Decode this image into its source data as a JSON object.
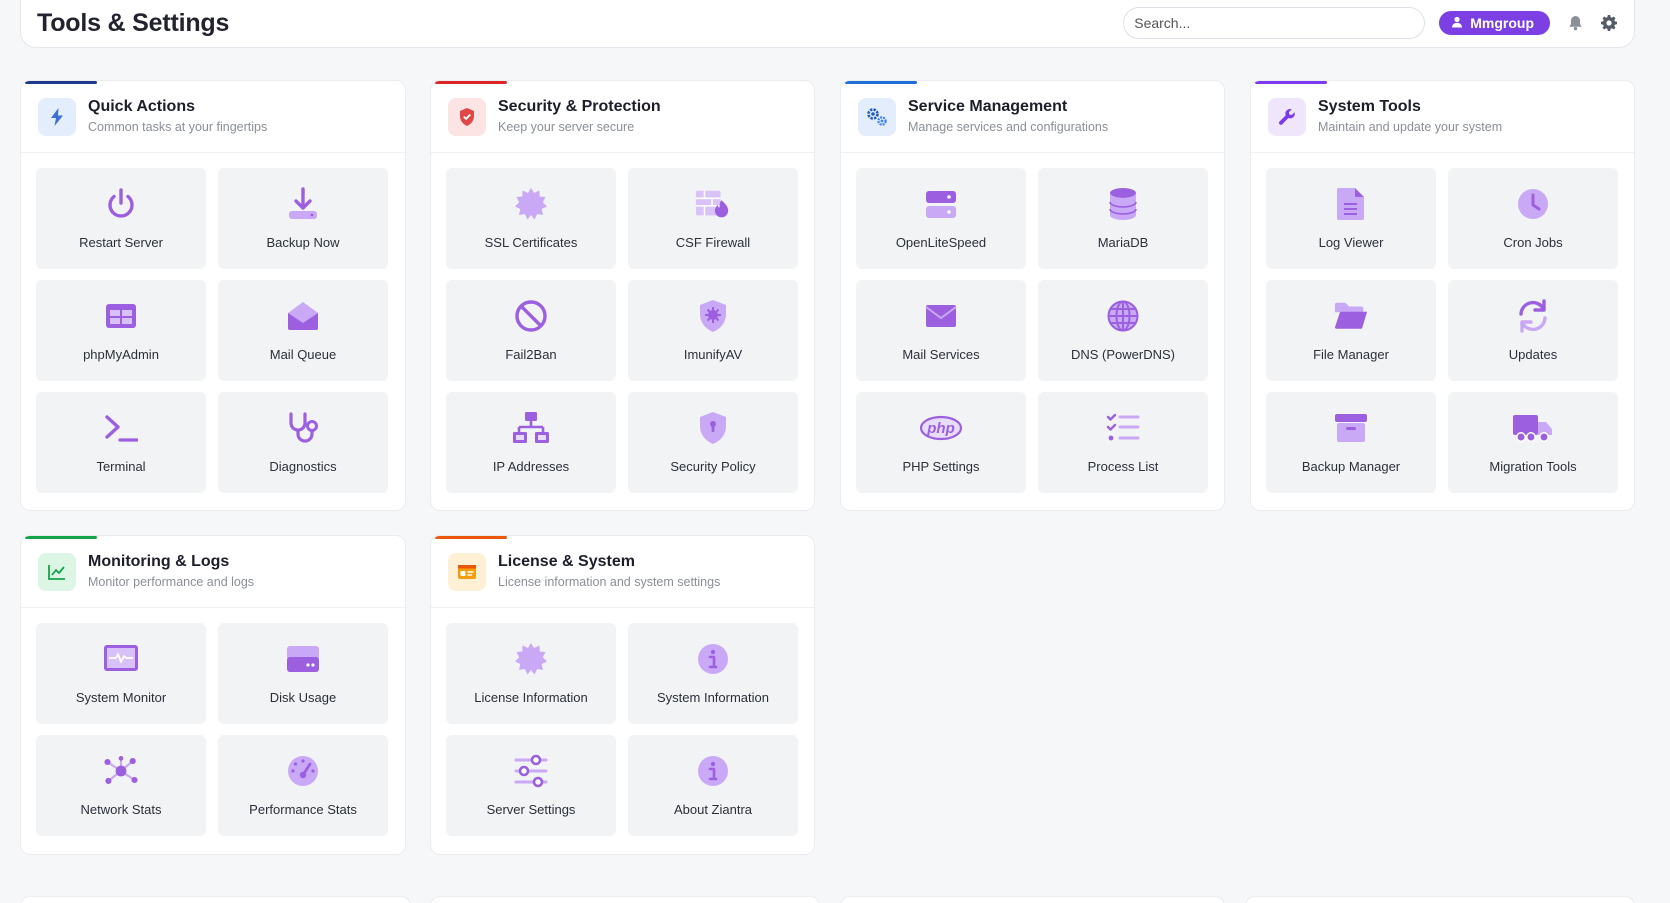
{
  "header": {
    "title": "Tools & Settings",
    "search_placeholder": "Search...",
    "user_label": "Mmgroup",
    "icons": [
      "bell-icon",
      "gear-icon"
    ]
  },
  "colors": {
    "accent": "#7b3fe4",
    "icon_purple": "#9b5fe0",
    "icon_light": "#c9a8f5",
    "quick_actions": "#1e3a8a",
    "security": "#dc2626",
    "service": "#1d6fd6",
    "system_tools": "#7c3aed",
    "monitoring": "#16a34a",
    "license": "#ea580c"
  },
  "sections": {
    "quick": {
      "title": "Quick Actions",
      "subtitle": "Common tasks at your fingertips",
      "items": [
        "Restart Server",
        "Backup Now",
        "phpMyAdmin",
        "Mail Queue",
        "Terminal",
        "Diagnostics"
      ]
    },
    "security": {
      "title": "Security & Protection",
      "subtitle": "Keep your server secure",
      "items": [
        "SSL Certificates",
        "CSF Firewall",
        "Fail2Ban",
        "ImunifyAV",
        "IP Addresses",
        "Security Policy"
      ]
    },
    "service": {
      "title": "Service Management",
      "subtitle": "Manage services and configurations",
      "items": [
        "OpenLiteSpeed",
        "MariaDB",
        "Mail Services",
        "DNS (PowerDNS)",
        "PHP Settings",
        "Process List"
      ],
      "php_text": "php"
    },
    "tools": {
      "title": "System Tools",
      "subtitle": "Maintain and update your system",
      "items": [
        "Log Viewer",
        "Cron Jobs",
        "File Manager",
        "Updates",
        "Backup Manager",
        "Migration Tools"
      ]
    },
    "monitoring": {
      "title": "Monitoring & Logs",
      "subtitle": "Monitor performance and logs",
      "items": [
        "System Monitor",
        "Disk Usage",
        "Network Stats",
        "Performance Stats"
      ]
    },
    "license": {
      "title": "License & System",
      "subtitle": "License information and system settings",
      "items": [
        "License Information",
        "System Information",
        "Server Settings",
        "About Ziantra"
      ]
    }
  }
}
